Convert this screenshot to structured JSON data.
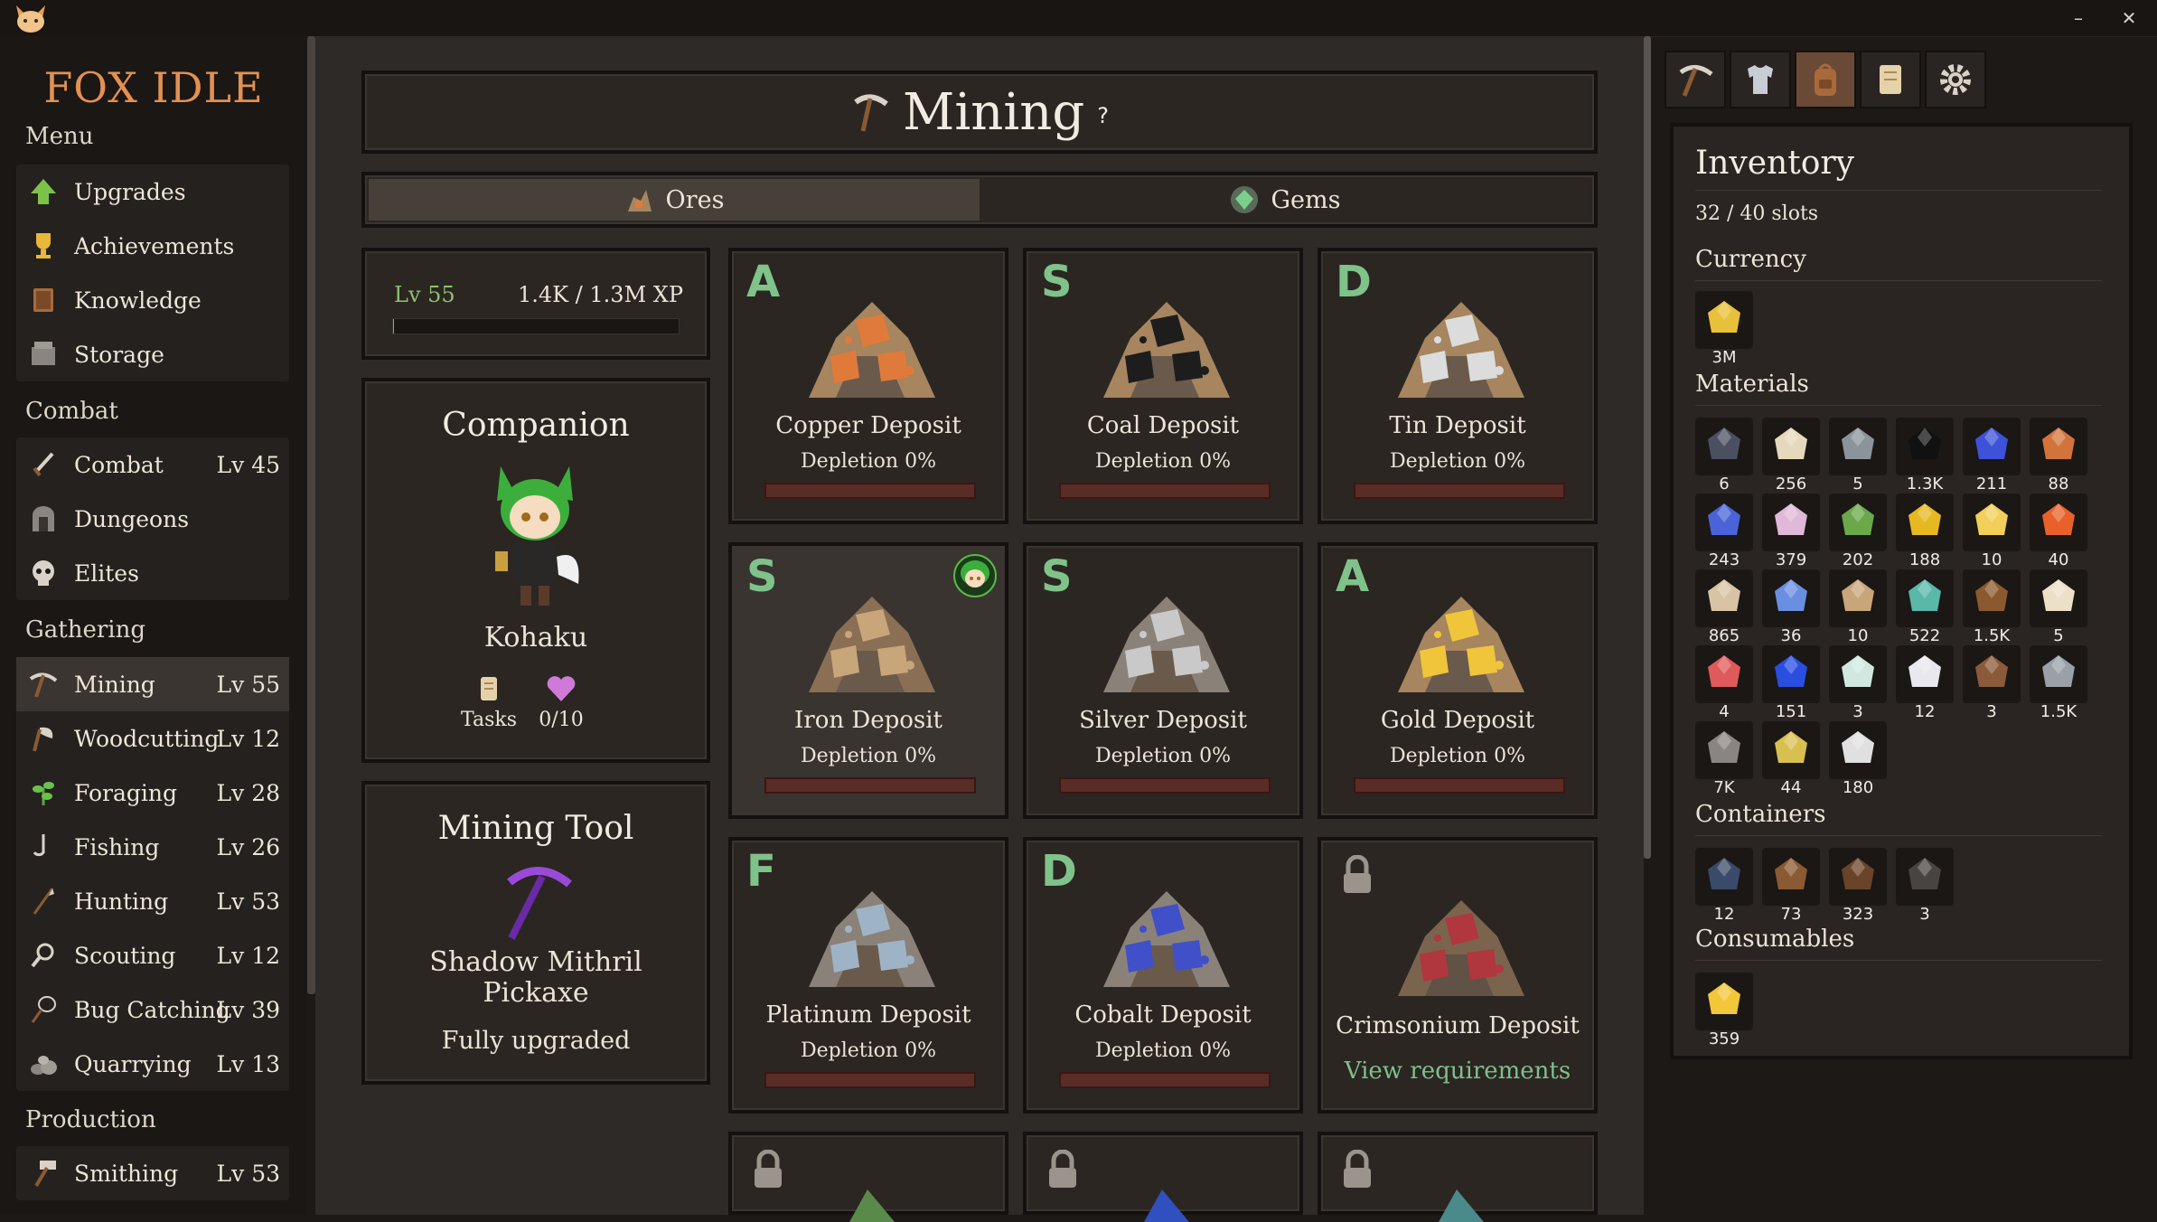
{
  "app": {
    "logo": "FOX IDLE"
  },
  "window": {
    "minimize": "–",
    "close": "✕"
  },
  "sidebar": {
    "menu_title": "Menu",
    "menu": [
      {
        "label": "Upgrades",
        "icon": "arrow-up-icon"
      },
      {
        "label": "Achievements",
        "icon": "trophy-icon"
      },
      {
        "label": "Knowledge",
        "icon": "book-icon"
      },
      {
        "label": "Storage",
        "icon": "storage-icon"
      }
    ],
    "combat_title": "Combat",
    "combat": [
      {
        "label": "Combat",
        "level": "Lv 45",
        "icon": "sword-icon"
      },
      {
        "label": "Dungeons",
        "level": "",
        "icon": "gate-icon"
      },
      {
        "label": "Elites",
        "level": "",
        "icon": "skull-icon"
      }
    ],
    "gathering_title": "Gathering",
    "gathering": [
      {
        "label": "Mining",
        "level": "Lv 55",
        "icon": "pickaxe-icon",
        "active": true
      },
      {
        "label": "Woodcutting",
        "level": "Lv 12",
        "icon": "axe-icon"
      },
      {
        "label": "Foraging",
        "level": "Lv 28",
        "icon": "herb-icon"
      },
      {
        "label": "Fishing",
        "level": "Lv 26",
        "icon": "hook-icon"
      },
      {
        "label": "Hunting",
        "level": "Lv 53",
        "icon": "spear-icon"
      },
      {
        "label": "Scouting",
        "level": "Lv 12",
        "icon": "magnifier-icon"
      },
      {
        "label": "Bug Catching",
        "level": "Lv 39",
        "icon": "net-icon"
      },
      {
        "label": "Quarrying",
        "level": "Lv 13",
        "icon": "rocks-icon"
      }
    ],
    "production_title": "Production",
    "production": [
      {
        "label": "Smithing",
        "level": "Lv 53",
        "icon": "hammer-icon"
      }
    ]
  },
  "main": {
    "title": "Mining",
    "help": "?",
    "tabs": [
      {
        "label": "Ores"
      },
      {
        "label": "Gems"
      }
    ],
    "skill": {
      "level": "Lv 55",
      "xp": "1.4K / 1.3M XP",
      "progress": 0.001
    },
    "companion": {
      "title": "Companion",
      "name": "Kohaku",
      "tasks_label": "Tasks",
      "hearts": "0/10"
    },
    "tool": {
      "title": "Mining Tool",
      "name": "Shadow Mithril Pickaxe",
      "status": "Fully upgraded"
    },
    "deposits": [
      {
        "grade": "A",
        "name": "Copper Deposit",
        "depletion": "Depletion 0%",
        "colors": [
          "#e07a3a",
          "#a6855f"
        ]
      },
      {
        "grade": "S",
        "name": "Coal Deposit",
        "depletion": "Depletion 0%",
        "colors": [
          "#1d1d1d",
          "#a6855f"
        ]
      },
      {
        "grade": "D",
        "name": "Tin Deposit",
        "depletion": "Depletion 0%",
        "colors": [
          "#dcdcdc",
          "#a6855f"
        ]
      },
      {
        "grade": "S",
        "name": "Iron Deposit",
        "depletion": "Depletion 0%",
        "colors": [
          "#c8a67a",
          "#8a6f55"
        ],
        "active": true
      },
      {
        "grade": "S",
        "name": "Silver Deposit",
        "depletion": "Depletion 0%",
        "colors": [
          "#c9c9c9",
          "#8a8179"
        ]
      },
      {
        "grade": "A",
        "name": "Gold Deposit",
        "depletion": "Depletion 0%",
        "colors": [
          "#f0c53a",
          "#a6855f"
        ]
      },
      {
        "grade": "F",
        "name": "Platinum Deposit",
        "depletion": "Depletion 0%",
        "colors": [
          "#9fb3c6",
          "#8a8179"
        ]
      },
      {
        "grade": "D",
        "name": "Cobalt Deposit",
        "depletion": "Depletion 0%",
        "colors": [
          "#4050c8",
          "#8a8179"
        ]
      },
      {
        "locked": true,
        "name": "Crimsonium Deposit",
        "requirements": "View requirements",
        "colors": [
          "#c83a44",
          "#8a6f55"
        ]
      }
    ]
  },
  "inventory": {
    "title": "Inventory",
    "slots": "32 / 40 slots",
    "currency_title": "Currency",
    "currency": [
      {
        "count": "3M",
        "color": "#e8c13a",
        "icon": "coins-icon"
      }
    ],
    "materials_title": "Materials",
    "materials": [
      {
        "count": "6",
        "color": "#4c4f60",
        "icon": "pearl-icon"
      },
      {
        "count": "256",
        "color": "#e6d8bd",
        "icon": "mushroom-icon"
      },
      {
        "count": "5",
        "color": "#8a949a",
        "icon": "fish-icon"
      },
      {
        "count": "1.3K",
        "color": "#111111",
        "icon": "coal-icon"
      },
      {
        "count": "211",
        "color": "#3d52d8",
        "icon": "sapphire-icon"
      },
      {
        "count": "88",
        "color": "#d2733c",
        "icon": "copper-bar-icon"
      },
      {
        "count": "243",
        "color": "#4a63d8",
        "icon": "flower-icon"
      },
      {
        "count": "379",
        "color": "#e0b8d8",
        "icon": "moth-icon"
      },
      {
        "count": "202",
        "color": "#6aa84a",
        "icon": "herb-icon"
      },
      {
        "count": "188",
        "color": "#e6b822",
        "icon": "gold-bar-icon"
      },
      {
        "count": "10",
        "color": "#f2cf5a",
        "icon": "gold-orb-icon"
      },
      {
        "count": "40",
        "color": "#e8612a",
        "icon": "goldfish-icon"
      },
      {
        "count": "865",
        "color": "#d8c3a4",
        "icon": "fish-icon"
      },
      {
        "count": "36",
        "color": "#6a8ee0",
        "icon": "fish-icon"
      },
      {
        "count": "10",
        "color": "#c8a67a",
        "icon": "iron-ore-icon"
      },
      {
        "count": "522",
        "color": "#59b8a8",
        "icon": "gem-icon"
      },
      {
        "count": "1.5K",
        "color": "#8a5a2e",
        "icon": "log-icon"
      },
      {
        "count": "5",
        "color": "#ece0c8",
        "icon": "fang-icon"
      },
      {
        "count": "4",
        "color": "#e05a5a",
        "icon": "fish-icon"
      },
      {
        "count": "151",
        "color": "#2a4ee0",
        "icon": "cobalt-icon"
      },
      {
        "count": "3",
        "color": "#d0e8e0",
        "icon": "opal-icon"
      },
      {
        "count": "12",
        "color": "#e8e8ee",
        "icon": "pearl-icon"
      },
      {
        "count": "3",
        "color": "#8a5a3a",
        "icon": "dirt-icon"
      },
      {
        "count": "1.5K",
        "color": "#9aa0a8",
        "icon": "iron-bar-icon"
      },
      {
        "count": "7K",
        "color": "#8a8580",
        "icon": "stone-icon"
      },
      {
        "count": "44",
        "color": "#d8c050",
        "icon": "eel-icon"
      },
      {
        "count": "180",
        "color": "#e0e0e0",
        "icon": "silver-bar-icon"
      }
    ],
    "containers_title": "Containers",
    "containers": [
      {
        "count": "12",
        "color": "#3a4a6a",
        "icon": "clam-icon"
      },
      {
        "count": "73",
        "color": "#8a5a32",
        "icon": "chest-icon"
      },
      {
        "count": "323",
        "color": "#6a4428",
        "icon": "crate-icon"
      },
      {
        "count": "3",
        "color": "#4a4440",
        "icon": "dark-chest-icon"
      }
    ],
    "consumables_title": "Consumables",
    "consumables": [
      {
        "count": "359",
        "color": "#f2c73a",
        "icon": "cheese-icon"
      }
    ]
  }
}
